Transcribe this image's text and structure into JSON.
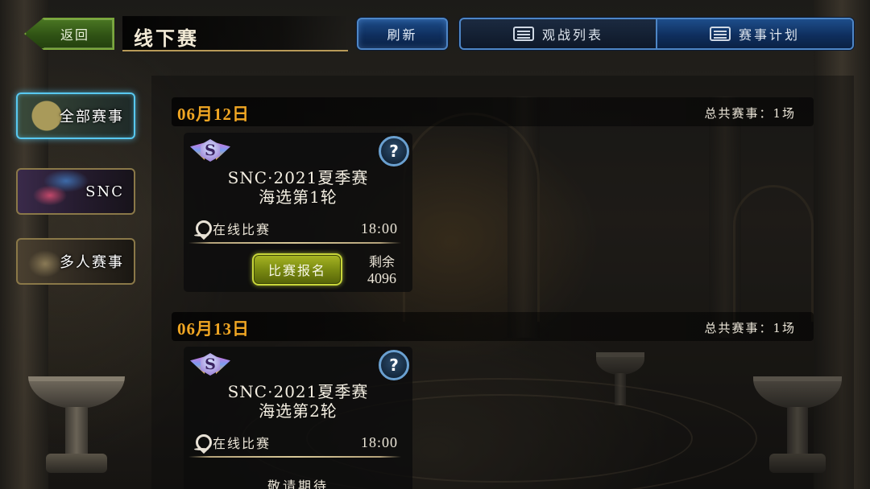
{
  "header": {
    "back_label": "返回",
    "title": "线下赛",
    "refresh_label": "刷新",
    "tabs": [
      {
        "label": "观战列表",
        "icon": "list-icon",
        "active": false
      },
      {
        "label": "赛事计划",
        "icon": "schedule-icon",
        "active": true
      }
    ]
  },
  "sidebar": {
    "items": [
      {
        "label": "全部赛事",
        "active": true
      },
      {
        "label": "SNC",
        "active": false
      },
      {
        "label": "多人赛事",
        "active": false
      }
    ]
  },
  "schedule": [
    {
      "date": "06月12日",
      "count": "总共赛事：1场",
      "events": [
        {
          "badge": "S",
          "help": "?",
          "title_line1": "SNC·2021夏季赛",
          "title_line2": "海选第1轮",
          "location": "在线比赛",
          "time": "18:00",
          "action_label": "比赛报名",
          "remain_label": "剩余",
          "remain_value": "4096"
        }
      ]
    },
    {
      "date": "06月13日",
      "count": "总共赛事：1场",
      "events": [
        {
          "badge": "S",
          "help": "?",
          "title_line1": "SNC·2021夏季赛",
          "title_line2": "海选第2轮",
          "location": "在线比赛",
          "time": "18:00",
          "status": "敬请期待"
        }
      ]
    }
  ],
  "colors": {
    "date_text": "#f0a623",
    "blue_button": "#1d4d8a",
    "green_back": "#4d7a24",
    "signup_button": "#a8b624",
    "active_border": "#58c8f0"
  }
}
